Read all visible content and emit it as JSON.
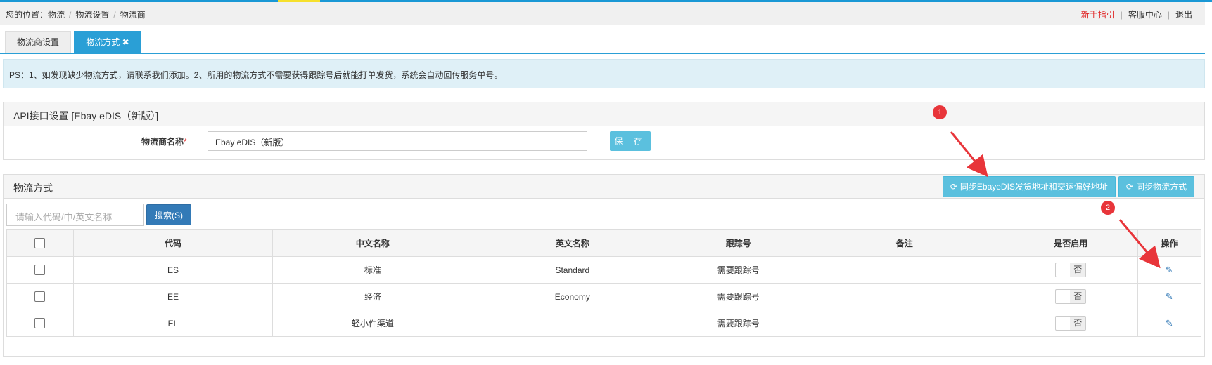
{
  "breadcrumb": {
    "prefix": "您的位置：",
    "items": [
      "物流",
      "物流设置",
      "物流商"
    ]
  },
  "top_links": {
    "guide": "新手指引",
    "service": "客服中心",
    "logout": "退出"
  },
  "tabs": [
    {
      "label": "物流商设置"
    },
    {
      "label": "物流方式 ✖"
    }
  ],
  "notice": "PS：1、如发现缺少物流方式，请联系我们添加。2、所用的物流方式不需要获得跟踪号后就能打单发货，系统会自动回传服务单号。",
  "api_panel": {
    "title": "API接口设置 [Ebay eDIS（新版）]",
    "name_label": "物流商名称",
    "required_mark": "*",
    "name_value": "Ebay eDIS（新版）",
    "save_label": "保 存"
  },
  "ship_panel": {
    "title": "物流方式",
    "sync_address_label": "同步EbayeDIS发货地址和交运偏好地址",
    "sync_methods_label": "同步物流方式",
    "search_placeholder": "请输入代码/中/英文名称",
    "search_label": "搜索(S)",
    "columns": [
      "代码",
      "中文名称",
      "英文名称",
      "跟踪号",
      "备注",
      "是否启用",
      "操作"
    ],
    "rows": [
      {
        "code": "ES",
        "cn": "标准",
        "en": "Standard",
        "tracking": "需要跟踪号",
        "note": "",
        "enabled": "否"
      },
      {
        "code": "EE",
        "cn": "经济",
        "en": "Economy",
        "tracking": "需要跟踪号",
        "note": "",
        "enabled": "否"
      },
      {
        "code": "EL",
        "cn": "轻小件渠道",
        "en": "",
        "tracking": "需要跟踪号",
        "note": "",
        "enabled": "否"
      }
    ]
  },
  "annotations": {
    "badge1": "1",
    "badge2": "2",
    "color": "#e8353a"
  },
  "colors": {
    "accent": "#2a9fd6",
    "info_button": "#5bc0de",
    "primary_button": "#337ab7",
    "notice_bg": "#dff0f7"
  },
  "icons": {
    "sync": "refresh-icon",
    "edit": "edit-icon",
    "close": "close-icon"
  }
}
